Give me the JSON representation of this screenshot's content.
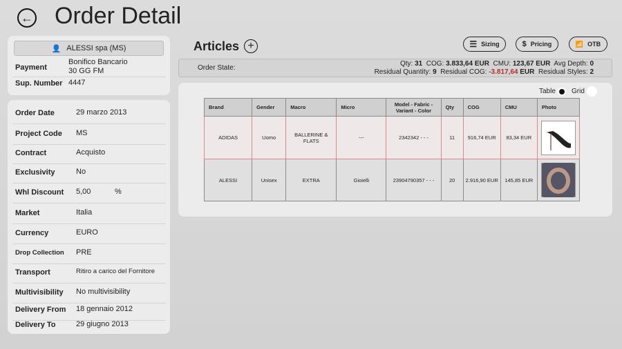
{
  "header": {
    "title": "Order Detail"
  },
  "supplier": {
    "name": "ALESSI spa (MS)",
    "payment_label": "Payment",
    "payment_value_1": "Bonifico Bancario",
    "payment_value_2": "30 GG FM",
    "sup_number_label": "Sup. Number",
    "sup_number": "4447"
  },
  "details": [
    {
      "label": "Order Date",
      "value": "29 marzo 2013"
    },
    {
      "label": "Project Code",
      "value": "MS"
    },
    {
      "label": "Contract",
      "value": "Acquisto"
    },
    {
      "label": "Exclusivity",
      "value": "No"
    },
    {
      "label": "Whl Discount",
      "value": "5,00",
      "unit": "%"
    },
    {
      "label": "Market",
      "value": "Italia"
    },
    {
      "label": "Currency",
      "value": "EURO"
    },
    {
      "label": "Drop Collection",
      "value": "PRE"
    },
    {
      "label": "Transport",
      "value": "Ritiro a carico del Fornitore"
    },
    {
      "label": "Multivisibility",
      "value": "No multivisibility"
    },
    {
      "label": "Delivery From",
      "value": "18 gennaio 2012"
    },
    {
      "label": "Delivery To",
      "value": "29 giugno 2013"
    }
  ],
  "articles": {
    "title": "Articles",
    "buttons": {
      "sizing": "Sizing",
      "pricing": "Pricing",
      "otb": "OTB"
    }
  },
  "order_state": {
    "label": "Order State:",
    "qty_label": "Qty:",
    "qty": "31",
    "cog_label": "COG:",
    "cog": "3.833,64 EUR",
    "cmu_label": "CMU:",
    "cmu": "123,67 EUR",
    "avg_depth_label": "Avg Depth:",
    "avg_depth": "0",
    "res_qty_label": "Residual Quantity:",
    "res_qty": "9",
    "res_cog_label": "Residual COG:",
    "res_cog": "-3.817,64",
    "res_cog_unit": "EUR",
    "res_styles_label": "Residual Styles:",
    "res_styles": "2",
    "negative_color": "#b23030"
  },
  "view": {
    "table": "Table",
    "grid": "Grid",
    "selected": "Table"
  },
  "table": {
    "columns": [
      "Brand",
      "Gender",
      "Macro",
      "Micro",
      "Model - Fabric - Variant - Color",
      "Qty",
      "COG",
      "CMU",
      "Photo"
    ],
    "rows": [
      {
        "brand": "ADIDAS",
        "gender": "Uomo",
        "macro": "BALLERINE & FLATS",
        "micro": "---",
        "model": "2342342 - - -",
        "qty": "11",
        "cog": "916,74 EUR",
        "cmu": "83,34 EUR",
        "photo": "shoe"
      },
      {
        "brand": "ALESSI",
        "gender": "Unisex",
        "macro": "EXTRA",
        "micro": "Gioielli",
        "model": "23904790357 - - -",
        "qty": "20",
        "cog": "2.916,90 EUR",
        "cmu": "145,85 EUR",
        "photo": "bracelet"
      }
    ]
  }
}
